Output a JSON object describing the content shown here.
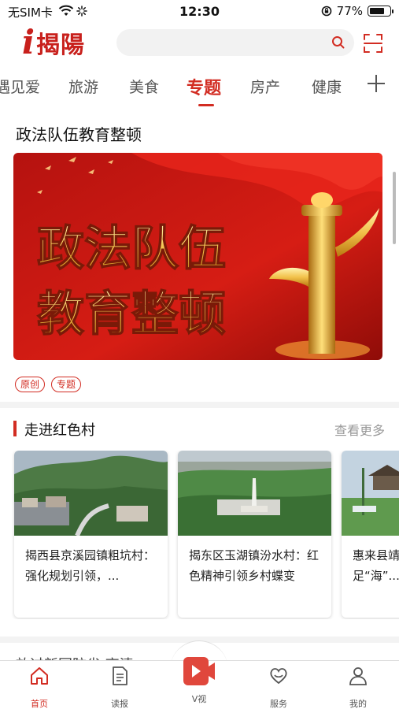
{
  "status_bar": {
    "carrier": "无SIM卡",
    "time": "12:30",
    "battery_percent_text": "77%",
    "battery_level": 0.77,
    "icons": [
      "wifi-icon",
      "loading-icon",
      "lock-rotation-icon",
      "battery-icon"
    ]
  },
  "header": {
    "logo_letter": "i",
    "logo_text": "揭陽",
    "search_placeholder": "",
    "search_icon": "search-icon",
    "scan_icon": "scan-icon"
  },
  "tabs": {
    "items": [
      {
        "label": "遇见爱"
      },
      {
        "label": "旅游"
      },
      {
        "label": "美食"
      },
      {
        "label": "专题",
        "active": true
      },
      {
        "label": "房产"
      },
      {
        "label": "健康"
      }
    ],
    "add_icon": "plus-icon"
  },
  "topic": {
    "title": "政法队伍教育整顿",
    "banner_line1": "政法队伍",
    "banner_line2": "教育整顿",
    "tags": [
      "原创",
      "专题"
    ]
  },
  "section": {
    "title": "走进红色村",
    "more": "查看更多",
    "cards": [
      {
        "title": "揭西县京溪园镇粗坑村：强化规划引领，..."
      },
      {
        "title": "揭东区玉湖镇汾水村：红色精神引领乡村蝶变"
      },
      {
        "title": "惠来县靖海镇：用足“海”..."
      }
    ]
  },
  "next_section_title": "放过新国防省·高清",
  "bottom_nav": {
    "items": [
      {
        "label": "首页",
        "icon": "home-icon",
        "active": true
      },
      {
        "label": "读报",
        "icon": "newspaper-icon"
      },
      {
        "label": "V视",
        "icon": "video-play-icon"
      },
      {
        "label": "服务",
        "icon": "heart-service-icon"
      },
      {
        "label": "我的",
        "icon": "person-icon"
      }
    ]
  },
  "colors": {
    "accent": "#d22c22",
    "brand": "#c8201c"
  }
}
